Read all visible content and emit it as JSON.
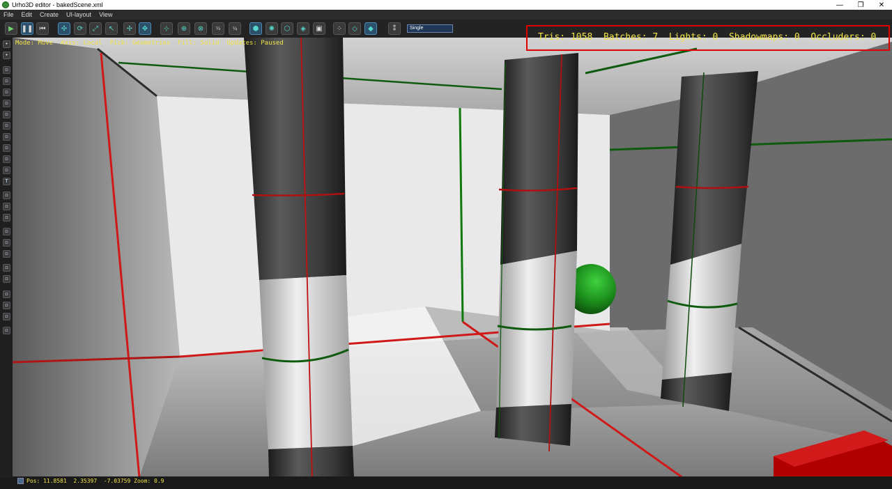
{
  "window": {
    "title": "Urho3D editor - bakedScene.xml",
    "minimize": "—",
    "maximize": "❐",
    "close": "✕"
  },
  "menu": [
    "File",
    "Edit",
    "Create",
    "UI-layout",
    "View"
  ],
  "toolbar": {
    "play_icon": "play-icon",
    "pause_icon": "pause-icon",
    "restart_icon": "restart-icon",
    "pick_mode": "Single"
  },
  "viewport_status": {
    "mode": "Mode: Move",
    "axis": "Axis: Local",
    "pick": "Pick: Geometries",
    "fill": "Fill: Solid",
    "updates": "Updates: Paused"
  },
  "stats": {
    "tris": "Tris: 1058",
    "batches": "Batches: 7",
    "lights": "Lights: 0",
    "shadowmaps": "Shadowmaps: 0",
    "occluders": "Occluders: 0"
  },
  "camera": {
    "pos": "Pos: 11.8581  2.35397  -7.03759 Zoom: 0.9"
  },
  "colors": {
    "accent_red": "#e00000",
    "stats_yellow": "#f2e44a",
    "sphere_green": "#1a8a1a"
  }
}
